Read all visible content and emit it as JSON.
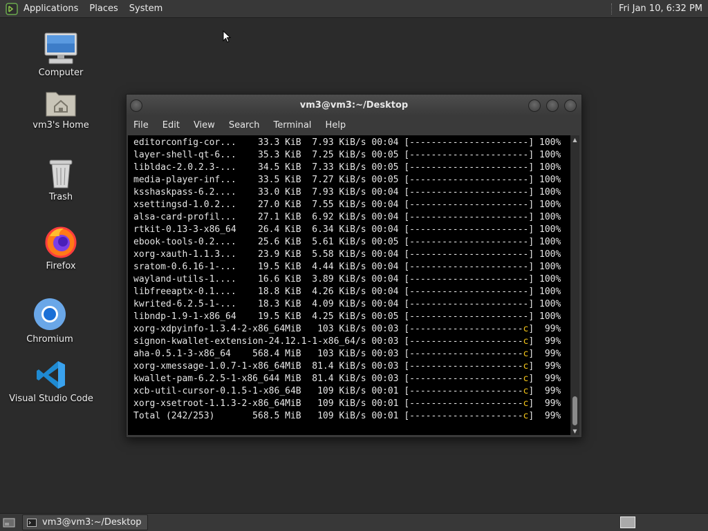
{
  "top_panel": {
    "menus": [
      "Applications",
      "Places",
      "System"
    ],
    "clock": "Fri Jan 10,  6:32 PM"
  },
  "desktop_icons": [
    {
      "label": "Computer",
      "icon": "computer-icon"
    },
    {
      "label": "vm3's Home",
      "icon": "home-folder-icon"
    },
    {
      "label": "Trash",
      "icon": "trash-icon"
    },
    {
      "label": "Firefox",
      "icon": "firefox-icon"
    },
    {
      "label": "Chromium",
      "icon": "chromium-icon"
    },
    {
      "label": "Visual Studio Code",
      "icon": "vscode-icon"
    }
  ],
  "terminal": {
    "title": "vm3@vm3:~/Desktop",
    "menu": [
      "File",
      "Edit",
      "View",
      "Search",
      "Terminal",
      "Help"
    ],
    "lines": [
      {
        "pre": "editorconfig-cor...    33.3 KiB  7.93 KiB/s 00:04 [----------------------",
        "hl": "",
        "post": "] 100%"
      },
      {
        "pre": "layer-shell-qt-6...    35.3 KiB  7.25 KiB/s 00:05 [----------------------",
        "hl": "",
        "post": "] 100%"
      },
      {
        "pre": "libldac-2.0.2.3-...    34.5 KiB  7.33 KiB/s 00:05 [----------------------",
        "hl": "",
        "post": "] 100%"
      },
      {
        "pre": "media-player-inf...    33.5 KiB  7.27 KiB/s 00:05 [----------------------",
        "hl": "",
        "post": "] 100%"
      },
      {
        "pre": "ksshaskpass-6.2....    33.0 KiB  7.93 KiB/s 00:04 [----------------------",
        "hl": "",
        "post": "] 100%"
      },
      {
        "pre": "xsettingsd-1.0.2...    27.0 KiB  7.55 KiB/s 00:04 [----------------------",
        "hl": "",
        "post": "] 100%"
      },
      {
        "pre": "alsa-card-profil...    27.1 KiB  6.92 KiB/s 00:04 [----------------------",
        "hl": "",
        "post": "] 100%"
      },
      {
        "pre": "rtkit-0.13-3-x86_64    26.4 KiB  6.34 KiB/s 00:04 [----------------------",
        "hl": "",
        "post": "] 100%"
      },
      {
        "pre": "ebook-tools-0.2....    25.6 KiB  5.61 KiB/s 00:05 [----------------------",
        "hl": "",
        "post": "] 100%"
      },
      {
        "pre": "xorg-xauth-1.1.3...    23.9 KiB  5.58 KiB/s 00:04 [----------------------",
        "hl": "",
        "post": "] 100%"
      },
      {
        "pre": "sratom-0.6.16-1-...    19.5 KiB  4.44 KiB/s 00:04 [----------------------",
        "hl": "",
        "post": "] 100%"
      },
      {
        "pre": "wayland-utils-1....    16.6 KiB  3.89 KiB/s 00:04 [----------------------",
        "hl": "",
        "post": "] 100%"
      },
      {
        "pre": "libfreeaptx-0.1....    18.8 KiB  4.26 KiB/s 00:04 [----------------------",
        "hl": "",
        "post": "] 100%"
      },
      {
        "pre": "kwrited-6.2.5-1-...    18.3 KiB  4.09 KiB/s 00:04 [----------------------",
        "hl": "",
        "post": "] 100%"
      },
      {
        "pre": "libndp-1.9-1-x86_64    19.5 KiB  4.25 KiB/s 00:05 [----------------------",
        "hl": "",
        "post": "] 100%"
      },
      {
        "pre": "xorg-xdpyinfo-1.3.4-2-x86_64MiB   103 KiB/s 00:03 [---------------------",
        "hl": "c",
        "post": "]  99%"
      },
      {
        "pre": "signon-kwallet-extension-24.12.1-1-x86_64/s 00:03 [---------------------",
        "hl": "c",
        "post": "]  99%"
      },
      {
        "pre": "aha-0.5.1-3-x86_64    568.4 MiB   103 KiB/s 00:03 [---------------------",
        "hl": "c",
        "post": "]  99%"
      },
      {
        "pre": "xorg-xmessage-1.0.7-1-x86_64MiB  81.4 KiB/s 00:03 [---------------------",
        "hl": "c",
        "post": "]  99%"
      },
      {
        "pre": "kwallet-pam-6.2.5-1-x86_644 MiB  81.4 KiB/s 00:03 [---------------------",
        "hl": "c",
        "post": "]  99%"
      },
      {
        "pre": "xcb-util-cursor-0.1.5-1-x86_64B   109 KiB/s 00:01 [---------------------",
        "hl": "c",
        "post": "]  99%"
      },
      {
        "pre": "xorg-xsetroot-1.1.3-2-x86_64MiB   109 KiB/s 00:01 [---------------------",
        "hl": "c",
        "post": "]  99%"
      },
      {
        "pre": "Total (242/253)       568.5 MiB   109 KiB/s 00:01 [---------------------",
        "hl": "c",
        "post": "]  99%"
      }
    ]
  },
  "taskbar": {
    "task_label": "vm3@vm3:~/Desktop"
  },
  "colors": {
    "desktop_bg": "#2b2b2b",
    "panel_bg": "#383838",
    "terminal_bg": "#000000",
    "progress_highlight": "#f5c518"
  }
}
